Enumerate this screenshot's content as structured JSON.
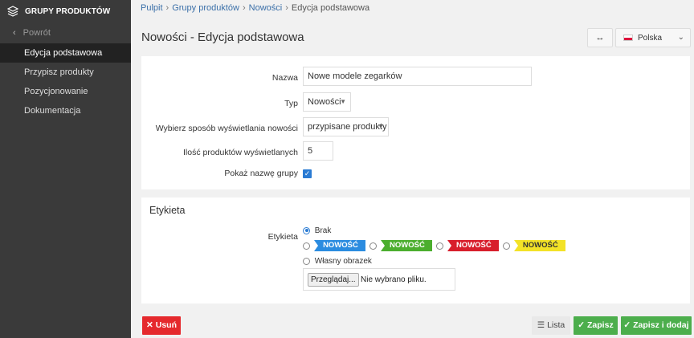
{
  "sidebar": {
    "title": "GRUPY PRODUKTÓW",
    "back_label": "Powrót",
    "items": [
      {
        "label": "Edycja podstawowa"
      },
      {
        "label": "Przypisz produkty"
      },
      {
        "label": "Pozycjonowanie"
      },
      {
        "label": "Dokumentacja"
      }
    ]
  },
  "breadcrumb": [
    "Pulpit",
    "Grupy produktów",
    "Nowości",
    "Edycja podstawowa"
  ],
  "page_title": "Nowości - Edycja podstawowa",
  "header": {
    "swap_icon": "↔",
    "language": "Polska"
  },
  "form": {
    "name_label": "Nazwa",
    "name_value": "Nowe modele zegarków",
    "type_label": "Typ",
    "type_value": "Nowości",
    "display_label": "Wybierz sposób wyświetlania nowości",
    "display_value": "przypisane produkty",
    "count_label": "Ilość produktów wyświetlanych",
    "count_value": "5",
    "show_name_label": "Pokaż nazwę grupy",
    "show_name_checked": true
  },
  "label_section": {
    "title": "Etykieta",
    "field_label": "Etykieta",
    "none_label": "Brak",
    "tag_text": "NOWOŚĆ",
    "tag_colors": [
      "#2b8ce0",
      "#4bae2e",
      "#d81e2c",
      "#f3e227"
    ],
    "custom_label": "Własny obrazek",
    "browse_label": "Przeglądaj...",
    "no_file_label": "Nie wybrano pliku."
  },
  "footer": {
    "delete_label": "Usuń",
    "list_label": "Lista",
    "save_label": "Zapisz",
    "save_add_label": "Zapisz i dodaj"
  }
}
